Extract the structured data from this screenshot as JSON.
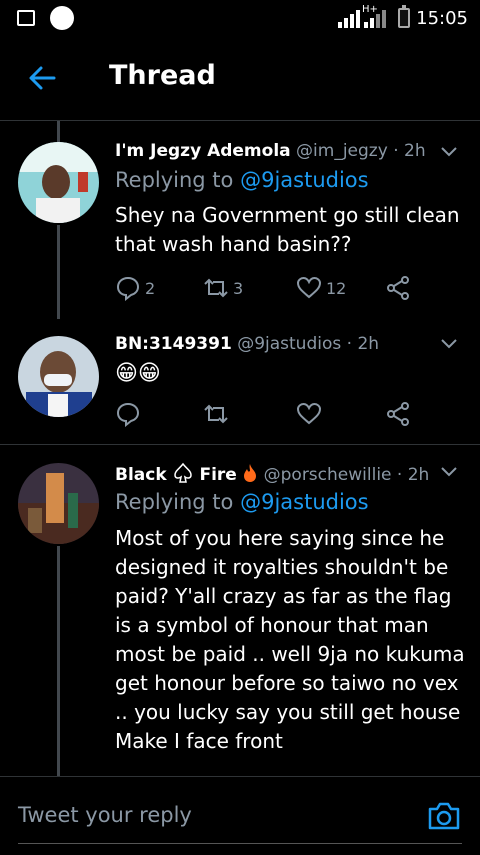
{
  "status_bar": {
    "time": "15:05",
    "network_label": "H+"
  },
  "header": {
    "title": "Thread"
  },
  "tweets": [
    {
      "name": "I'm Jegzy Ademola",
      "handle": "@im_jegzy",
      "time": "· 2h",
      "replying_prefix": "Replying to",
      "replying_to": "@9jastudios",
      "text": "Shey na Government go still clean that wash hand basin??",
      "reply_count": "2",
      "retweet_count": "3",
      "like_count": "12"
    },
    {
      "name": "BN:3149391",
      "handle": "@9jastudios",
      "time": "· 2h",
      "text": "😁😁",
      "reply_count": "",
      "retweet_count": "",
      "like_count": ""
    },
    {
      "name": "Black",
      "name_suffix": "Fire",
      "handle": "@porschewillie",
      "time": "· 2h",
      "replying_prefix": "Replying to",
      "replying_to": "@9jastudios",
      "text": "Most of you here saying since he designed it royalties shouldn't be paid? Y'all crazy as far as the flag is a symbol of honour that man most be paid .. well 9ja no kukuma get honour before so taiwo no vex .. you lucky say you still get house Make I face front"
    }
  ],
  "reply_bar": {
    "placeholder": "Tweet your reply"
  },
  "colors": {
    "accent": "#1d9bf0",
    "muted": "#8b98a5",
    "background": "#000000"
  }
}
